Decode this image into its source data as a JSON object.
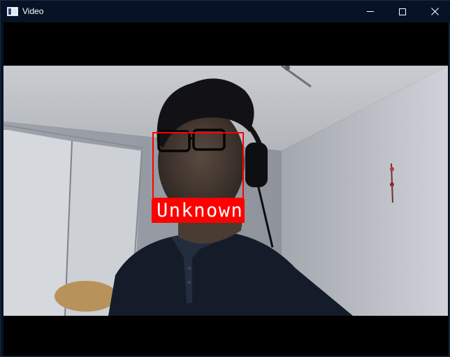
{
  "window": {
    "title": "Video"
  },
  "titlebar": {
    "app_icon": "video-window-icon",
    "buttons": {
      "minimize": "minimize-icon",
      "maximize": "maximize-icon",
      "close": "close-icon"
    }
  },
  "detection": {
    "label": "Unknown",
    "box_color": "#ff0000",
    "label_text_color": "#ffffff"
  },
  "colors": {
    "titlebar_bg": "#061326",
    "video_bg": "#000000"
  }
}
